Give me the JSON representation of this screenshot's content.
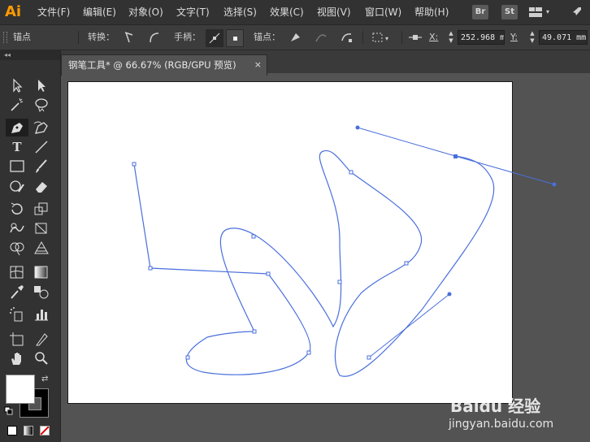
{
  "app": {
    "logo": "Ai"
  },
  "menu": [
    "文件(F)",
    "编辑(E)",
    "对象(O)",
    "文字(T)",
    "选择(S)",
    "效果(C)",
    "视图(V)",
    "窗口(W)",
    "帮助(H)"
  ],
  "app_buttons": [
    "Br",
    "St"
  ],
  "controlbar": {
    "mode_label": "锚点",
    "convert_label": "转换：",
    "handles_label": "手柄：",
    "anchor_label": "锚点：",
    "x_label": "X:",
    "x_value": "252.968 m",
    "y_label": "Y:",
    "y_value": "49.071 mm"
  },
  "toolpanel": {
    "collapse": "◂◂"
  },
  "document": {
    "tab_title": "钢笔工具* @ 66.67% (RGB/GPU 预览)",
    "close": "×"
  },
  "colors": {
    "path": "#4a6fdc",
    "fill": "#ffffff",
    "stroke": "#000000",
    "accent": "#ff9a00"
  },
  "watermark": {
    "text": "Baidu 经验",
    "url": "jingyan.baidu.com"
  }
}
